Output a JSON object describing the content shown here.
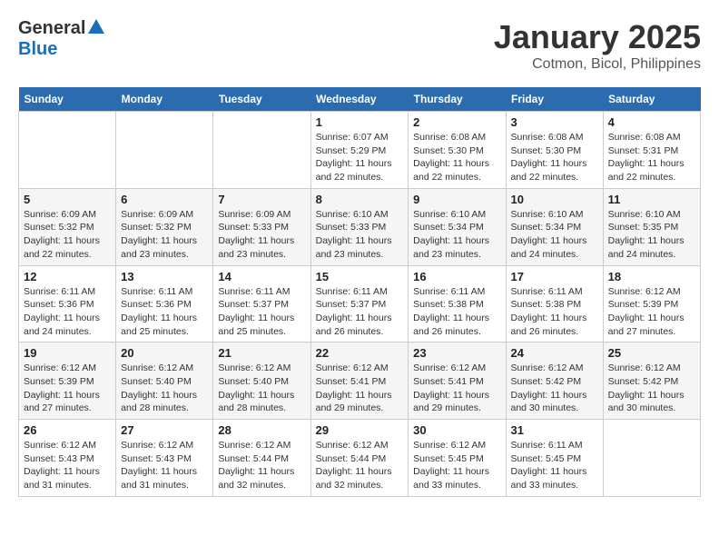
{
  "logo": {
    "general": "General",
    "blue": "Blue"
  },
  "header": {
    "month": "January 2025",
    "location": "Cotmon, Bicol, Philippines"
  },
  "weekdays": [
    "Sunday",
    "Monday",
    "Tuesday",
    "Wednesday",
    "Thursday",
    "Friday",
    "Saturday"
  ],
  "weeks": [
    [
      {
        "day": "",
        "info": ""
      },
      {
        "day": "",
        "info": ""
      },
      {
        "day": "",
        "info": ""
      },
      {
        "day": "1",
        "info": "Sunrise: 6:07 AM\nSunset: 5:29 PM\nDaylight: 11 hours and 22 minutes."
      },
      {
        "day": "2",
        "info": "Sunrise: 6:08 AM\nSunset: 5:30 PM\nDaylight: 11 hours and 22 minutes."
      },
      {
        "day": "3",
        "info": "Sunrise: 6:08 AM\nSunset: 5:30 PM\nDaylight: 11 hours and 22 minutes."
      },
      {
        "day": "4",
        "info": "Sunrise: 6:08 AM\nSunset: 5:31 PM\nDaylight: 11 hours and 22 minutes."
      }
    ],
    [
      {
        "day": "5",
        "info": "Sunrise: 6:09 AM\nSunset: 5:32 PM\nDaylight: 11 hours and 22 minutes."
      },
      {
        "day": "6",
        "info": "Sunrise: 6:09 AM\nSunset: 5:32 PM\nDaylight: 11 hours and 23 minutes."
      },
      {
        "day": "7",
        "info": "Sunrise: 6:09 AM\nSunset: 5:33 PM\nDaylight: 11 hours and 23 minutes."
      },
      {
        "day": "8",
        "info": "Sunrise: 6:10 AM\nSunset: 5:33 PM\nDaylight: 11 hours and 23 minutes."
      },
      {
        "day": "9",
        "info": "Sunrise: 6:10 AM\nSunset: 5:34 PM\nDaylight: 11 hours and 23 minutes."
      },
      {
        "day": "10",
        "info": "Sunrise: 6:10 AM\nSunset: 5:34 PM\nDaylight: 11 hours and 24 minutes."
      },
      {
        "day": "11",
        "info": "Sunrise: 6:10 AM\nSunset: 5:35 PM\nDaylight: 11 hours and 24 minutes."
      }
    ],
    [
      {
        "day": "12",
        "info": "Sunrise: 6:11 AM\nSunset: 5:36 PM\nDaylight: 11 hours and 24 minutes."
      },
      {
        "day": "13",
        "info": "Sunrise: 6:11 AM\nSunset: 5:36 PM\nDaylight: 11 hours and 25 minutes."
      },
      {
        "day": "14",
        "info": "Sunrise: 6:11 AM\nSunset: 5:37 PM\nDaylight: 11 hours and 25 minutes."
      },
      {
        "day": "15",
        "info": "Sunrise: 6:11 AM\nSunset: 5:37 PM\nDaylight: 11 hours and 26 minutes."
      },
      {
        "day": "16",
        "info": "Sunrise: 6:11 AM\nSunset: 5:38 PM\nDaylight: 11 hours and 26 minutes."
      },
      {
        "day": "17",
        "info": "Sunrise: 6:11 AM\nSunset: 5:38 PM\nDaylight: 11 hours and 26 minutes."
      },
      {
        "day": "18",
        "info": "Sunrise: 6:12 AM\nSunset: 5:39 PM\nDaylight: 11 hours and 27 minutes."
      }
    ],
    [
      {
        "day": "19",
        "info": "Sunrise: 6:12 AM\nSunset: 5:39 PM\nDaylight: 11 hours and 27 minutes."
      },
      {
        "day": "20",
        "info": "Sunrise: 6:12 AM\nSunset: 5:40 PM\nDaylight: 11 hours and 28 minutes."
      },
      {
        "day": "21",
        "info": "Sunrise: 6:12 AM\nSunset: 5:40 PM\nDaylight: 11 hours and 28 minutes."
      },
      {
        "day": "22",
        "info": "Sunrise: 6:12 AM\nSunset: 5:41 PM\nDaylight: 11 hours and 29 minutes."
      },
      {
        "day": "23",
        "info": "Sunrise: 6:12 AM\nSunset: 5:41 PM\nDaylight: 11 hours and 29 minutes."
      },
      {
        "day": "24",
        "info": "Sunrise: 6:12 AM\nSunset: 5:42 PM\nDaylight: 11 hours and 30 minutes."
      },
      {
        "day": "25",
        "info": "Sunrise: 6:12 AM\nSunset: 5:42 PM\nDaylight: 11 hours and 30 minutes."
      }
    ],
    [
      {
        "day": "26",
        "info": "Sunrise: 6:12 AM\nSunset: 5:43 PM\nDaylight: 11 hours and 31 minutes."
      },
      {
        "day": "27",
        "info": "Sunrise: 6:12 AM\nSunset: 5:43 PM\nDaylight: 11 hours and 31 minutes."
      },
      {
        "day": "28",
        "info": "Sunrise: 6:12 AM\nSunset: 5:44 PM\nDaylight: 11 hours and 32 minutes."
      },
      {
        "day": "29",
        "info": "Sunrise: 6:12 AM\nSunset: 5:44 PM\nDaylight: 11 hours and 32 minutes."
      },
      {
        "day": "30",
        "info": "Sunrise: 6:12 AM\nSunset: 5:45 PM\nDaylight: 11 hours and 33 minutes."
      },
      {
        "day": "31",
        "info": "Sunrise: 6:11 AM\nSunset: 5:45 PM\nDaylight: 11 hours and 33 minutes."
      },
      {
        "day": "",
        "info": ""
      }
    ]
  ]
}
